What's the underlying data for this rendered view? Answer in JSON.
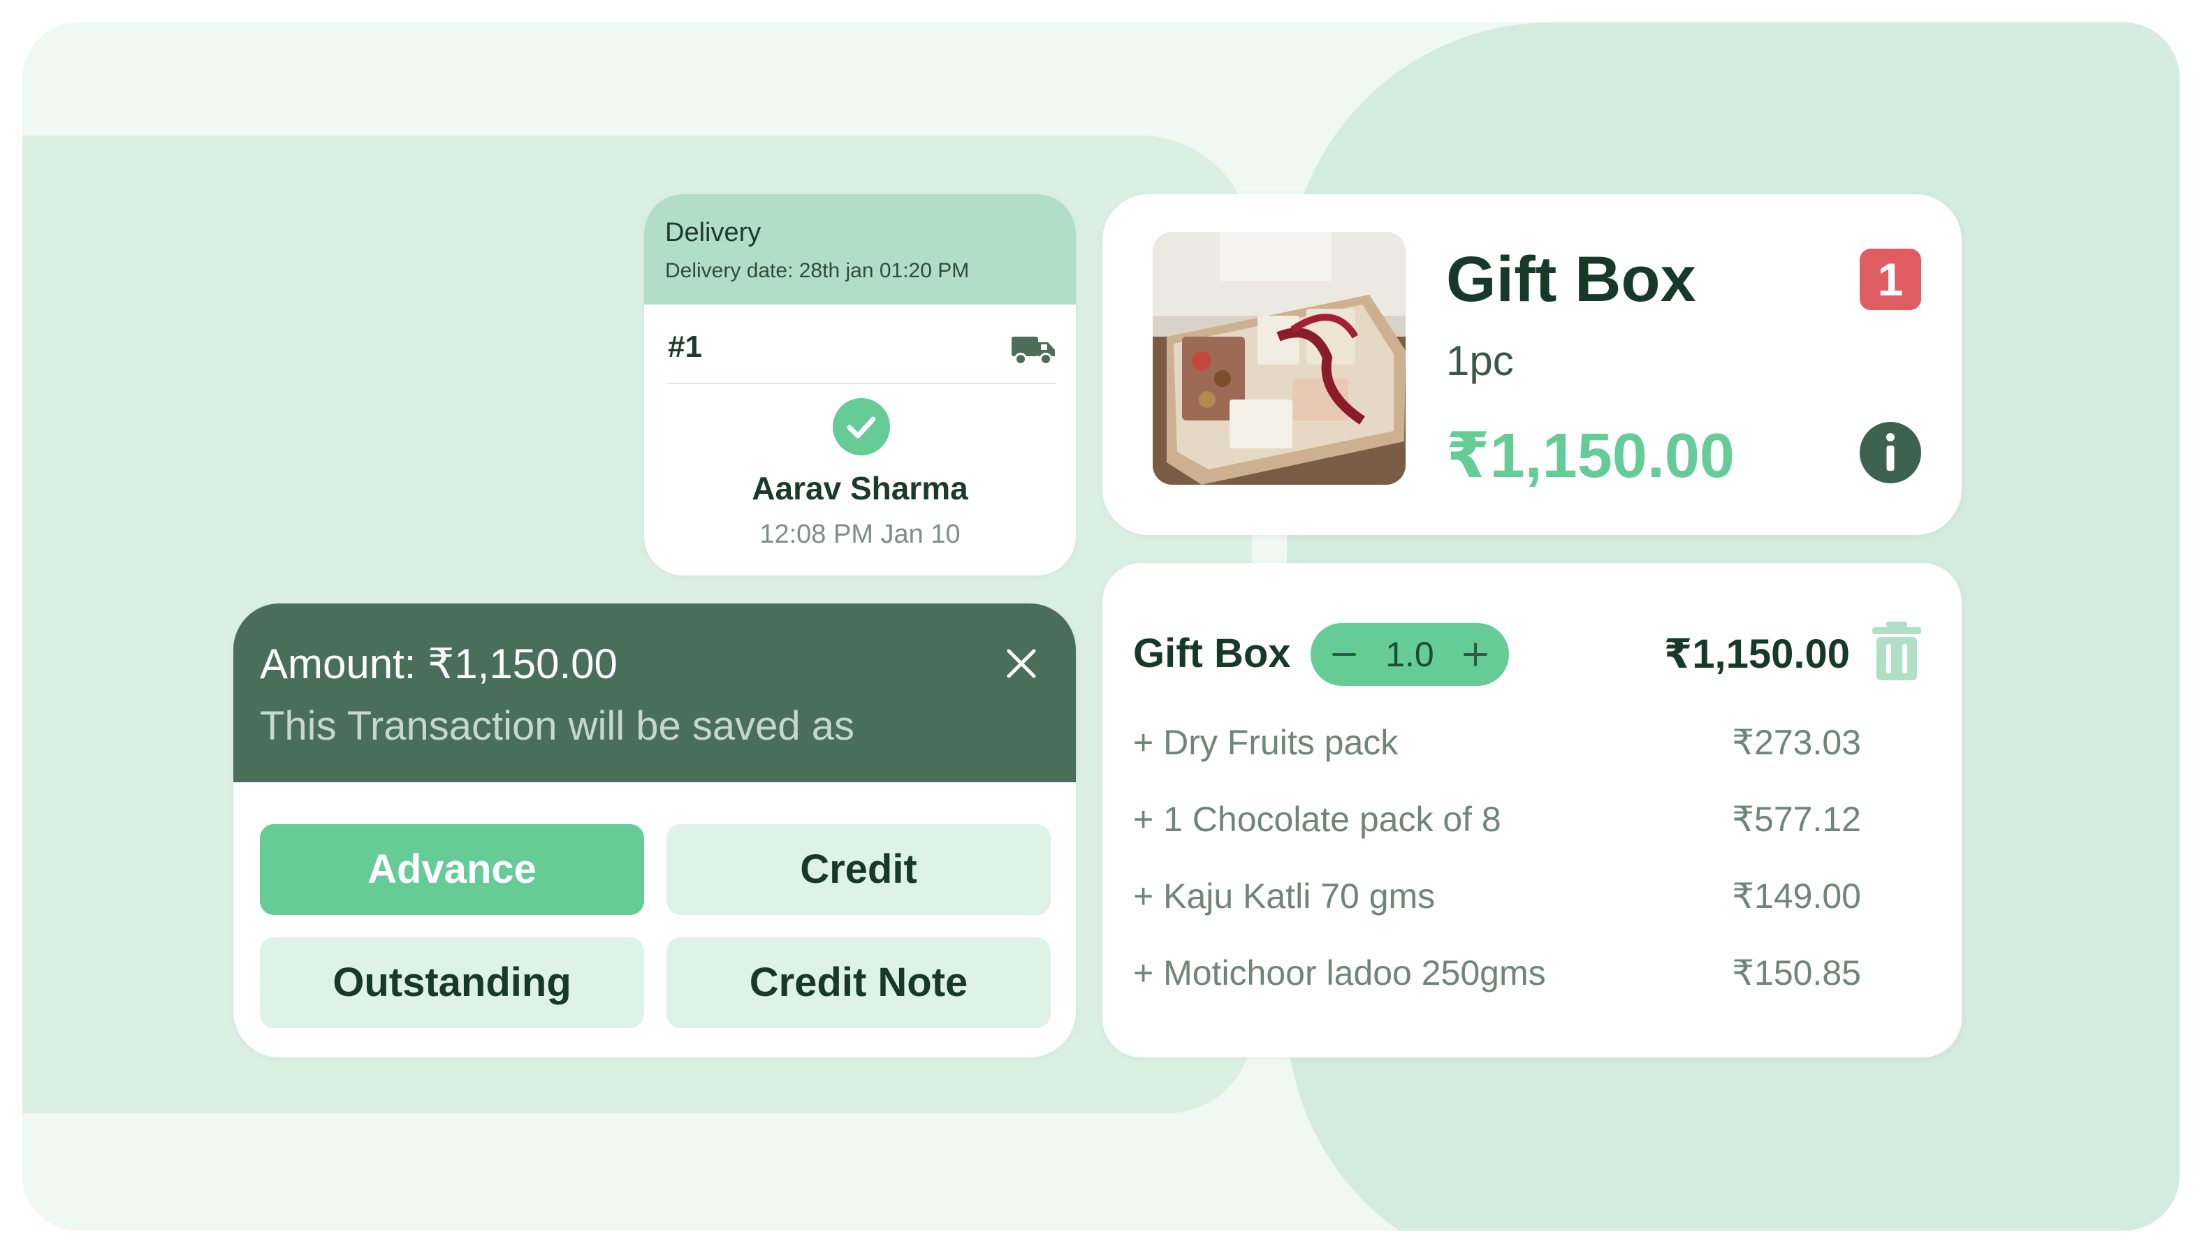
{
  "colors": {
    "accent": "#65cc98",
    "dark_green": "#496f5a",
    "badge_red": "#df5c63",
    "header_mint": "#b1dfc6"
  },
  "delivery": {
    "title": "Delivery",
    "date": "Delivery date: 28th jan 01:20 PM",
    "order_number": "#1",
    "icon": "truck-icon",
    "status_icon": "check-circle-icon",
    "customer_name": "Aarav Sharma",
    "timestamp": "12:08 PM Jan 10"
  },
  "product": {
    "name": "Gift Box",
    "quantity": "1pc",
    "price": "₹1,150.00",
    "count_badge": "1",
    "info_icon": "info-icon"
  },
  "cart": {
    "item_name": "Gift Box",
    "stepper_value": "1.0",
    "item_price": "₹1,150.00",
    "addons": [
      {
        "name": "+ Dry Fruits pack",
        "price": "₹273.03"
      },
      {
        "name": "+ 1 Chocolate pack of 8",
        "price": "₹577.12"
      },
      {
        "name": "+ Kaju Katli 70 gms",
        "price": "₹149.00"
      },
      {
        "name": "+ Motichoor ladoo 250gms",
        "price": "₹150.85"
      }
    ]
  },
  "transaction": {
    "amount": "Amount: ₹1,150.00",
    "subtitle": "This Transaction will be saved as",
    "options": [
      "Advance",
      "Credit",
      "Outstanding",
      "Credit Note"
    ],
    "selected": "Advance"
  }
}
